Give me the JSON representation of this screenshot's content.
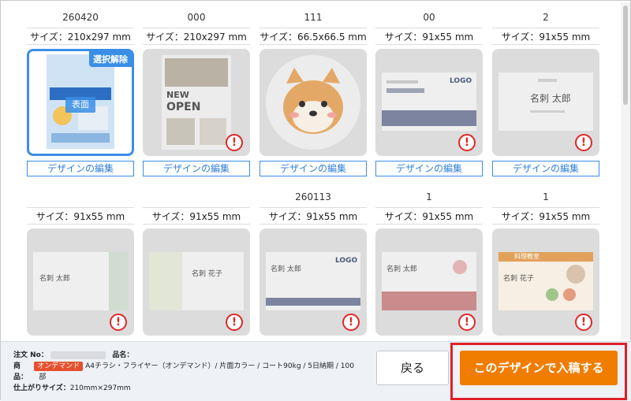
{
  "cards": [
    {
      "name": "260420",
      "size": "サイズ：210x297 mm",
      "edit": "デザインの編集",
      "selected_badge": "選択解除",
      "face_label": "表面"
    },
    {
      "name": "000",
      "size": "サイズ：210x297 mm",
      "edit": "デザインの編集"
    },
    {
      "name": "111",
      "size": "サイズ：66.5x66.5 mm",
      "edit": "デザインの編集"
    },
    {
      "name": "00",
      "size": "サイズ：91x55 mm",
      "edit": "デザインの編集"
    },
    {
      "name": "2",
      "size": "サイズ：91x55 mm",
      "edit": "デザインの編集"
    },
    {
      "name": "",
      "size": "サイズ：91x55 mm"
    },
    {
      "name": "",
      "size": "サイズ：91x55 mm"
    },
    {
      "name": "260113",
      "size": "サイズ：91x55 mm"
    },
    {
      "name": "1",
      "size": "サイズ：91x55 mm"
    },
    {
      "name": "1",
      "size": "サイズ：91x55 mm"
    }
  ],
  "alert_glyph": "!",
  "thumb_text": {
    "t2_open": "OPEN",
    "t2_new": "NEW",
    "t4_logo": "LOGO",
    "t5_name": "名刺 太郎",
    "t6_name": "名刺 太郎",
    "t7_name": "名刺 花子",
    "t8_logo": "LOGO",
    "t8_name": "名刺 太郎",
    "t9_name": "名刺 太郎",
    "t10_title": "料理教室",
    "t10_name": "名刺 花子"
  },
  "footer": {
    "order_label": "注文 No：",
    "product_label": "品名：",
    "product_label_2": "商",
    "product_label_3": "品：",
    "ondemand_tag": "オンデマンド",
    "product_desc": "A4チラシ・フライヤー（オンデマンド）/ 片面カラー / コート90kg / 5日納期 / 100",
    "unit": "部",
    "finish_label": "仕上がりサイズ：",
    "finish_value": "210mm×297mm",
    "back_label": "戻る",
    "submit_label": "このデザインで入稿する"
  },
  "colors": {
    "accent": "#3a8ee6",
    "submit": "#f07d00",
    "highlight": "#e01f26",
    "alert": "#e02727",
    "tag": "#e6502e"
  }
}
